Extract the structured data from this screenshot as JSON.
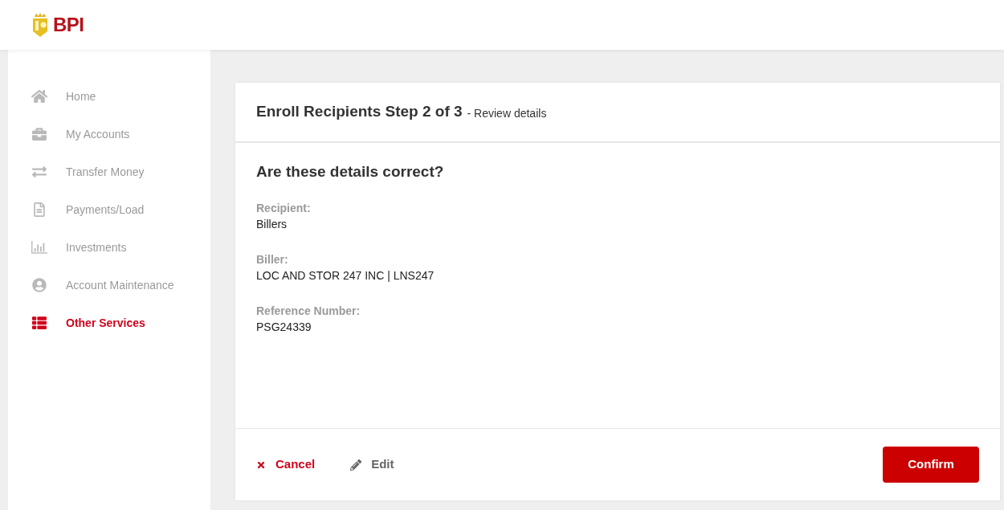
{
  "logo": {
    "text": "BPI"
  },
  "sidebar": {
    "items": [
      {
        "label": "Home",
        "kind": "home",
        "selected": false
      },
      {
        "label": "My Accounts",
        "kind": "accounts",
        "selected": false
      },
      {
        "label": "Transfer Money",
        "kind": "transfer",
        "selected": false
      },
      {
        "label": "Payments/Load",
        "kind": "payments",
        "selected": false
      },
      {
        "label": "Investments",
        "kind": "investments",
        "selected": false
      },
      {
        "label": "Account Maintenance",
        "kind": "maintenance",
        "selected": false
      },
      {
        "label": "Other Services",
        "kind": "services",
        "selected": true
      }
    ]
  },
  "card": {
    "title": "Enroll Recipients Step 2 of 3",
    "subtitle": "- Review details",
    "question": "Are these details correct?",
    "fields": [
      {
        "label": "Recipient:",
        "value": "Billers"
      },
      {
        "label": "Biller:",
        "value": "LOC AND STOR 247 INC | LNS247"
      },
      {
        "label": "Reference Number:",
        "value": "PSG24339"
      }
    ],
    "actions": {
      "cancel": "Cancel",
      "edit": "Edit",
      "confirm": "Confirm"
    }
  }
}
